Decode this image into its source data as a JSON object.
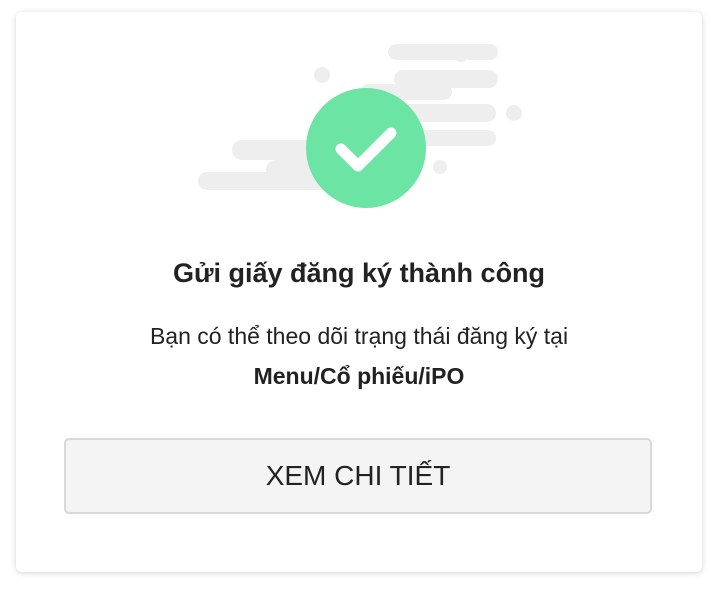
{
  "dialog": {
    "title": "Gửi giấy đăng ký thành công",
    "message_line1": "Bạn có thể theo dõi trạng thái đăng ký tại",
    "message_path": "Menu/Cổ phiếu/iPO",
    "button_label": "XEM CHI TIẾT",
    "icon": "check-circle-icon"
  },
  "colors": {
    "success_green": "#6ce4a3",
    "cloud_gray": "#eeeeee",
    "button_bg": "#f4f4f4",
    "button_border": "#d9d9d9",
    "text": "#222222"
  }
}
